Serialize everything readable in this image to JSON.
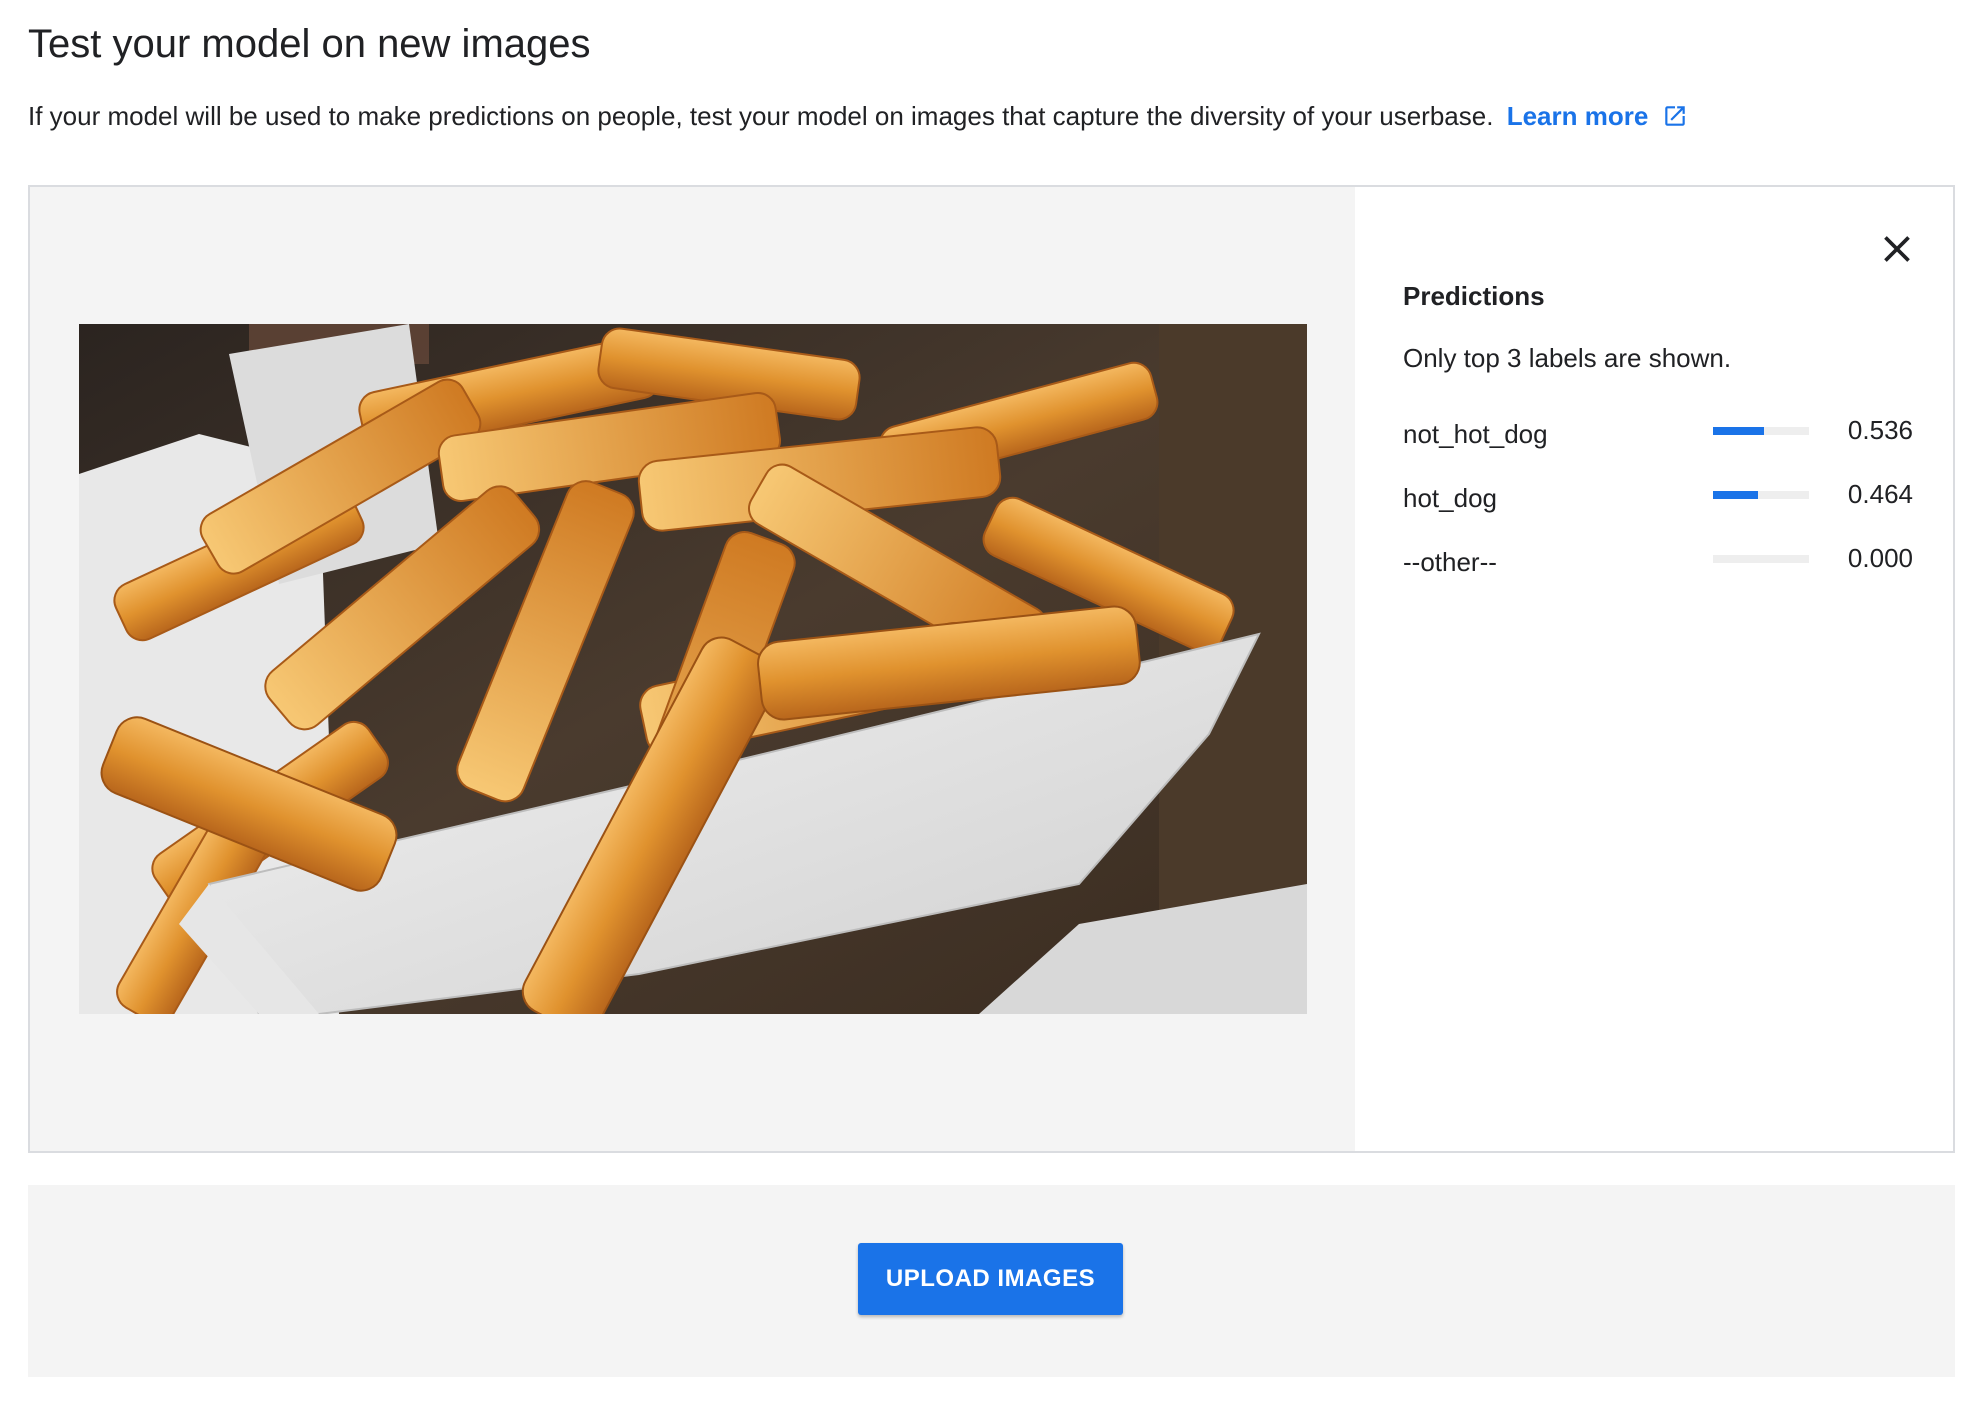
{
  "header": {
    "title": "Test your model on new images",
    "subtitle": "If your model will be used to make predictions on people, test your model on images that capture the diversity of your userbase.",
    "learn_more_label": "Learn more"
  },
  "predictions": {
    "title": "Predictions",
    "note": "Only top 3 labels are shown.",
    "bar_color": "#1a73e8",
    "items": [
      {
        "label": "not_hot_dog",
        "value": "0.536",
        "score": 0.536
      },
      {
        "label": "hot_dog",
        "value": "0.464",
        "score": 0.464
      },
      {
        "label": "--other--",
        "value": "0.000",
        "score": 0.0
      }
    ]
  },
  "upload": {
    "button_label": "UPLOAD IMAGES"
  },
  "icons": {
    "close": "close-icon",
    "external_link": "external-link-icon"
  },
  "colors": {
    "accent": "#1a73e8",
    "panel_bg": "#f4f4f4"
  }
}
